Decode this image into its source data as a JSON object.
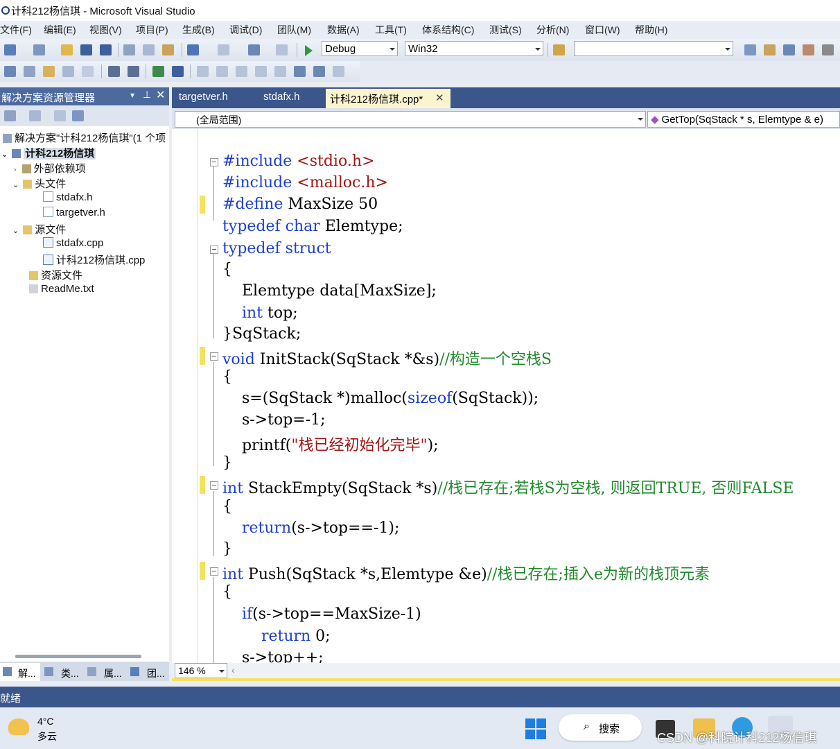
{
  "window": {
    "title": "计科212杨信琪 - Microsoft Visual Studio"
  },
  "menu": [
    "文件(F)",
    "编辑(E)",
    "视图(V)",
    "项目(P)",
    "生成(B)",
    "调试(D)",
    "团队(M)",
    "数据(A)",
    "工具(T)",
    "体系结构(C)",
    "测试(S)",
    "分析(N)",
    "窗口(W)",
    "帮助(H)"
  ],
  "toolbar": {
    "config": "Debug",
    "platform": "Win32",
    "find": ""
  },
  "solution_explorer": {
    "title": "解决方案资源管理器",
    "items": [
      {
        "label": "解决方案\"计科212杨信琪\"(1 个项",
        "depth": 0
      },
      {
        "label": "计科212杨信琪",
        "depth": 1
      },
      {
        "label": "外部依赖项",
        "depth": 2
      },
      {
        "label": "头文件",
        "depth": 2
      },
      {
        "label": "stdafx.h",
        "depth": 3
      },
      {
        "label": "targetver.h",
        "depth": 3
      },
      {
        "label": "源文件",
        "depth": 2
      },
      {
        "label": "stdafx.cpp",
        "depth": 3
      },
      {
        "label": "计科212杨信琪.cpp",
        "depth": 3
      },
      {
        "label": "资源文件",
        "depth": 2
      },
      {
        "label": "ReadMe.txt",
        "depth": 2
      }
    ],
    "bottom_tabs": [
      "解...",
      "类...",
      "属...",
      "团..."
    ]
  },
  "editor": {
    "tabs": [
      "targetver.h",
      "stdafx.h",
      "计科212杨信琪.cpp*"
    ],
    "scope": "(全局范围)",
    "member": "GetTop(SqStack * s, Elemtype & e)",
    "zoom": "146 %"
  },
  "status": {
    "text": "就绪"
  },
  "taskbar": {
    "temp": "4°C",
    "weather": "多云",
    "search": "搜索",
    "watermark": "CSDN @科院计科212杨信琪"
  }
}
